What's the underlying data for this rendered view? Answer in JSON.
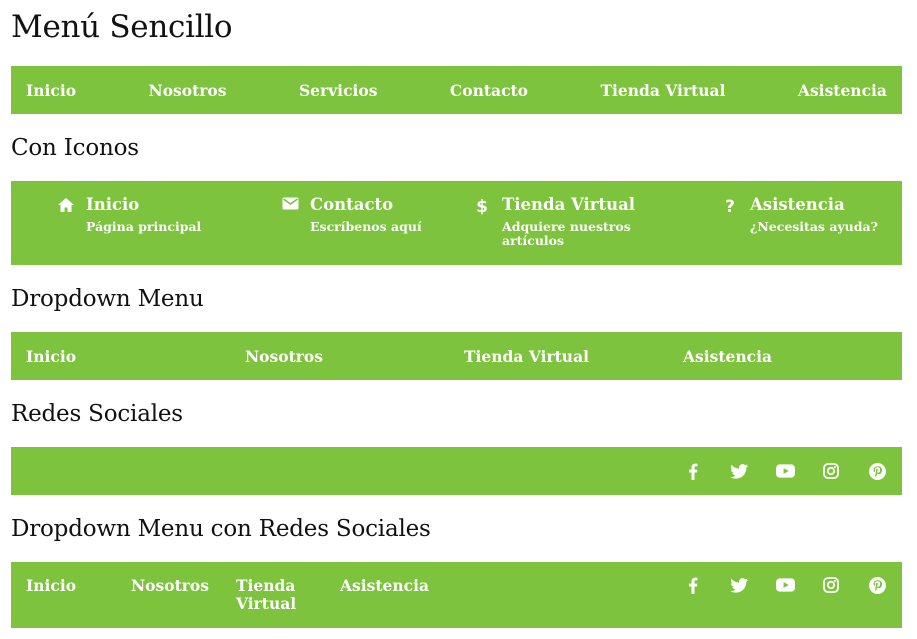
{
  "titles": {
    "main": "Menú Sencillo",
    "icons": "Con Iconos",
    "dropdown": "Dropdown Menu",
    "social": "Redes Sociales",
    "dropdown_social": "Dropdown Menu con Redes Sociales"
  },
  "menu_simple": [
    "Inicio",
    "Nosotros",
    "Servicios",
    "Contacto",
    "Tienda Virtual",
    "Asistencia"
  ],
  "menu_icons": [
    {
      "icon": "home-icon",
      "title": "Inicio",
      "subtitle": "Página principal"
    },
    {
      "icon": "envelope-icon",
      "title": "Contacto",
      "subtitle": "Escríbenos aquí"
    },
    {
      "icon": "dollar-icon",
      "title": "Tienda Virtual",
      "subtitle": "Adquiere nuestros artículos"
    },
    {
      "icon": "question-icon",
      "title": "Asistencia",
      "subtitle": "¿Necesitas ayuda?"
    }
  ],
  "menu_dropdown": [
    "Inicio",
    "Nosotros",
    "Tienda Virtual",
    "Asistencia"
  ],
  "social_icons": [
    "facebook-icon",
    "twitter-icon",
    "youtube-icon",
    "instagram-icon",
    "pinterest-icon"
  ],
  "menu_dropdown_social": [
    "Inicio",
    "Nosotros",
    "Tienda Virtual",
    "Asistencia"
  ],
  "colors": {
    "bar": "#7dc33d",
    "text": "#ffffff"
  }
}
